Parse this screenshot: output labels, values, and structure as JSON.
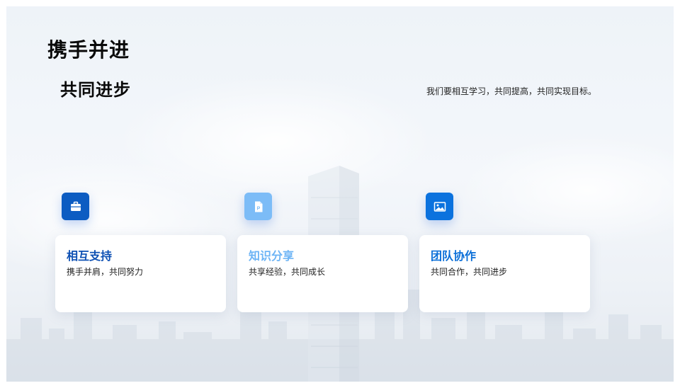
{
  "title": "携手并进",
  "subtitle": "共同进步",
  "tagline": "我们要相互学习，共同提高，共同实现目标。",
  "colors": {
    "dark_blue": "#0c5cc2",
    "light_blue": "#7cbcf7",
    "mid_blue": "#0b72de",
    "card_title_dark": "#0c4fb3",
    "card_title_light": "#6db4f5",
    "card_title_mid": "#0b6fd8"
  },
  "cards": [
    {
      "icon": "briefcase-icon",
      "title": "相互支持",
      "desc": "携手并肩，共同努力"
    },
    {
      "icon": "document-icon",
      "title": "知识分享",
      "desc": "共享经验，共同成长"
    },
    {
      "icon": "image-icon",
      "title": "团队协作",
      "desc": "共同合作，共同进步"
    }
  ]
}
